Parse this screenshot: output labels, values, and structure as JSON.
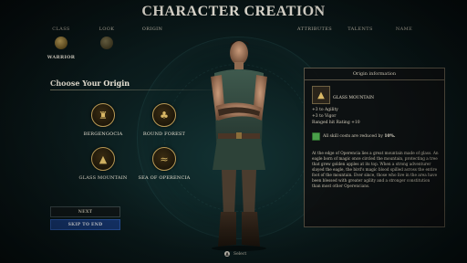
{
  "header": {
    "title": "CHARACTER CREATION"
  },
  "steps": [
    {
      "label": "CLASS"
    },
    {
      "label": "LOOK"
    },
    {
      "label": "ORIGIN"
    },
    {
      "label": "ATTRIBUTES"
    },
    {
      "label": "TALENTS"
    },
    {
      "label": "NAME"
    }
  ],
  "selected_class": "WARRIOR",
  "origin_section": {
    "heading": "Choose Your Origin",
    "origins": [
      {
        "name": "BERGENGOCIA",
        "icon": "fortress-icon"
      },
      {
        "name": "ROUND FOREST",
        "icon": "forest-icon"
      },
      {
        "name": "GLASS MOUNTAIN",
        "icon": "mountain-icon"
      },
      {
        "name": "SEA OF OPERENCIA",
        "icon": "sea-icon"
      }
    ]
  },
  "buttons": {
    "next": "NEXT",
    "skip": "SKIP TO END"
  },
  "info_panel": {
    "header": "Origin information",
    "origin_name": "GLASS MOUNTAIN",
    "stats": [
      "+3 to Agility",
      "+3 to Vigor",
      "Ranged hit Rating +10"
    ],
    "reduction_text": "All skill costs are reduced by",
    "reduction_value": "10%.",
    "description": "At the edge of Operencia lies a great mountain made of glass. An eagle born of magic once circled the mountain, protecting a tree that grew golden apples at its top. When a strong adventurer slayed the eagle, the bird's magic blood spilled across the entire foot of the mountain. Ever since, those who live in the area have been blessed with greater agility and a stronger constitution than most other Operencians."
  },
  "hint": {
    "button_glyph": "A",
    "label": "Select"
  },
  "colors": {
    "accent_gold": "#b99a55",
    "skip_button": "#173a78",
    "panel_bg": "#0e1011"
  }
}
